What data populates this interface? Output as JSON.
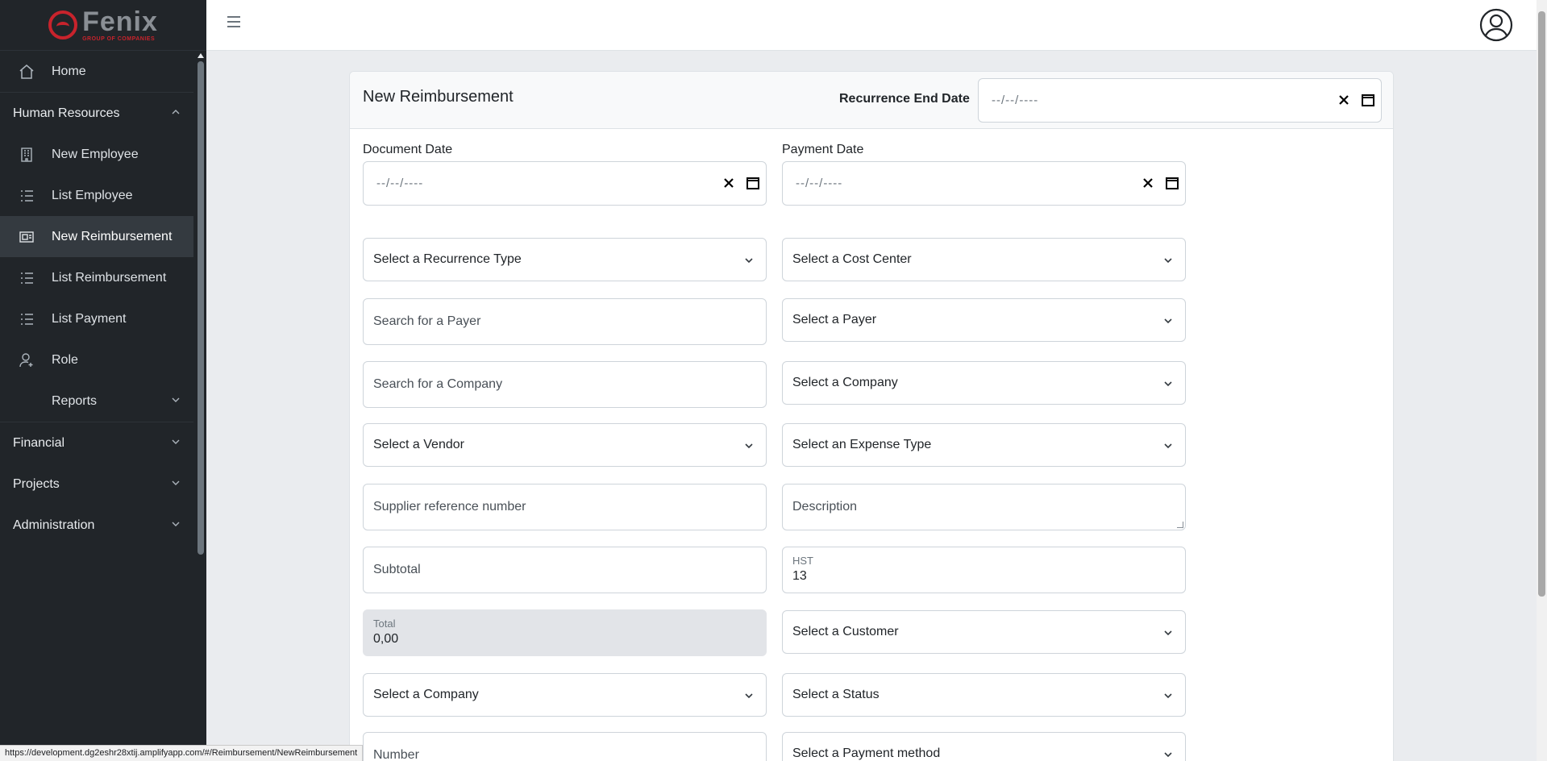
{
  "brand": {
    "name": "Fenix",
    "tagline": "GROUP OF COMPANIES",
    "accent": "#c8232c"
  },
  "sidebar": {
    "items": [
      {
        "label": "Home",
        "icon": "home-icon",
        "level": "top"
      },
      {
        "label": "Human Resources",
        "icon": "",
        "level": "group",
        "expanded": true
      },
      {
        "label": "New Employee",
        "icon": "building-icon",
        "level": "sub"
      },
      {
        "label": "List Employee",
        "icon": "list-icon",
        "level": "sub"
      },
      {
        "label": "New Reimbursement",
        "icon": "receipt-icon",
        "level": "sub",
        "active": true
      },
      {
        "label": "List Reimbursement",
        "icon": "list-icon",
        "level": "sub"
      },
      {
        "label": "List Payment",
        "icon": "list-icon",
        "level": "sub"
      },
      {
        "label": "Role",
        "icon": "user-plus-icon",
        "level": "sub"
      },
      {
        "label": "Reports",
        "icon": "",
        "level": "sub",
        "expanded": false
      },
      {
        "label": "Financial",
        "icon": "",
        "level": "group",
        "expanded": false
      },
      {
        "label": "Projects",
        "icon": "",
        "level": "group",
        "expanded": false
      },
      {
        "label": "Administration",
        "icon": "",
        "level": "group",
        "expanded": false
      }
    ]
  },
  "header": {
    "menu_icon": "hamburger-icon",
    "user_icon": "user-circle-icon"
  },
  "form": {
    "title": "New Reimbursement",
    "recurrence_end_date": {
      "label": "Recurrence End Date",
      "placeholder": "--/--/----"
    },
    "document_date": {
      "label": "Document Date",
      "placeholder": "--/--/----"
    },
    "payment_date": {
      "label": "Payment Date",
      "placeholder": "--/--/----"
    },
    "recurrence_type": "Select a Recurrence Type",
    "cost_center": "Select a Cost Center",
    "payer_search": "Search for a Payer",
    "payer_select": "Select a Payer",
    "company_search": "Search for a Company",
    "company_select": "Select a Company",
    "vendor": "Select a Vendor",
    "expense_type": "Select an Expense Type",
    "supplier_ref": "Supplier reference number",
    "description": "Description",
    "subtotal": "Subtotal",
    "hst": {
      "label": "HST",
      "value": "13"
    },
    "total": {
      "label": "Total",
      "value": "0,00"
    },
    "customer": "Select a Customer",
    "company_select_2": "Select a Company",
    "status": "Select a Status",
    "number": "Number",
    "payment_method": "Select a Payment method"
  },
  "status_url": "https://development.dg2eshr28xtij.amplifyapp.com/#/Reimbursement/NewReimbursement"
}
